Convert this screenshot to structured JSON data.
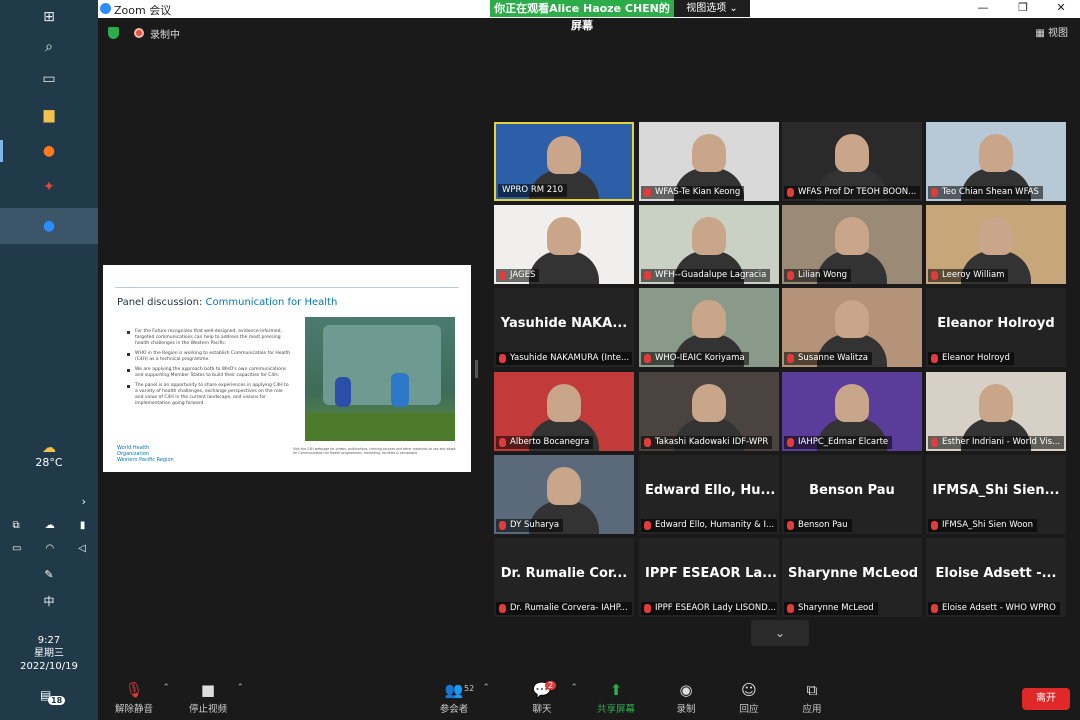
{
  "window": {
    "title": "Zoom 会议",
    "banner": "你正在观看Alice Haoze CHEN的屏幕",
    "view_options": "视图选项 ⌄",
    "controls": [
      "—",
      "❐",
      "✕"
    ]
  },
  "status": {
    "recording_label": "录制中",
    "view_label": "视图"
  },
  "shared_slide": {
    "title_prefix": "Panel discussion: ",
    "title_highlight": "Communication for Health",
    "bullets": [
      "For the Future recognizes that well-designed, evidence-informed, targeted communications can help to address the most pressing health challenges in the Western Pacific.",
      "WHO in the Region is working to establish Communication for Health (C4H) as a technical programme.",
      "We are applying the approach both to WHO's own communications and supporting Member States to build their capacities for C4H.",
      "The panel is an opportunity to share experiences in applying C4H to a variety of health challenges, exchange perspectives on the role and value of C4H in the current landscape, and visions for implementation going forward."
    ],
    "org_line1": "World Health",
    "org_line2": "Organization",
    "org_line3": "Western Pacific Region",
    "caption": "Visit the C4H webpage for videos, publications, training courses and other materials to use and adapt for Communication for Health programmes, marketing, facilities & campaigns"
  },
  "participants": [
    {
      "label": "WPRO RM 210",
      "big_name": "",
      "video": true,
      "active": true,
      "bg": "#2c5fa8",
      "muted": false
    },
    {
      "label": "WFAS-Te Kian Keong",
      "big_name": "",
      "video": true,
      "bg": "#d9d9d9"
    },
    {
      "label": "WFAS Prof Dr TEOH BOON...",
      "big_name": "",
      "video": true,
      "bg": "#2a2a2a"
    },
    {
      "label": "Teo Chian Shean WFAS",
      "big_name": "",
      "video": true,
      "bg": "#b7c9d6"
    },
    {
      "label": "JAGES",
      "big_name": "",
      "video": true,
      "bg": "#f0efee"
    },
    {
      "label": "WFH--Guadalupe Lagracia",
      "big_name": "",
      "video": true,
      "bg": "#c9d1c5"
    },
    {
      "label": "Lilian Wong",
      "big_name": "",
      "video": true,
      "bg": "#9b8a76"
    },
    {
      "label": "Leeroy William",
      "big_name": "",
      "video": true,
      "bg": "#c7a77a"
    },
    {
      "label": "Yasuhide NAKAMURA (Inte...",
      "big_name": "Yasuhide NAKA...",
      "video": false
    },
    {
      "label": "WHO-IEAIC Koriyama",
      "big_name": "",
      "video": true,
      "bg": "#8a9a8a"
    },
    {
      "label": "Susanne Walitza",
      "big_name": "",
      "video": true,
      "bg": "#b49378"
    },
    {
      "label": "Eleanor Holroyd",
      "big_name": "Eleanor Holroyd",
      "video": false
    },
    {
      "label": "Alberto Bocanegra",
      "big_name": "",
      "video": true,
      "bg": "#c23a3a"
    },
    {
      "label": "Takashi Kadowaki IDF-WPR",
      "big_name": "",
      "video": true,
      "bg": "#4a4340"
    },
    {
      "label": "IAHPC_Edmar Elcarte",
      "big_name": "",
      "video": true,
      "bg": "#5a3c9a"
    },
    {
      "label": "Esther Indriani - World Vis...",
      "big_name": "",
      "video": true,
      "bg": "#d6d0c6"
    },
    {
      "label": "DY Suharya",
      "big_name": "",
      "video": true,
      "bg": "#5a6a7a"
    },
    {
      "label": "Edward Ello, Humanity & I...",
      "big_name": "Edward Ello, Hu...",
      "video": false
    },
    {
      "label": "Benson Pau",
      "big_name": "Benson Pau",
      "video": false
    },
    {
      "label": "IFMSA_Shi Sien Woon",
      "big_name": "IFMSA_Shi Sien...",
      "video": false
    },
    {
      "label": "Dr. Rumalie Corvera- IAHP...",
      "big_name": "Dr. Rumalie Cor...",
      "video": false
    },
    {
      "label": "IPPF ESEAOR Lady LISOND...",
      "big_name": "IPPF ESEAOR La...",
      "video": false
    },
    {
      "label": "Sharynne McLeod",
      "big_name": "Sharynne McLeod",
      "video": false
    },
    {
      "label": "Eloise Adsett - WHO WPRO",
      "big_name": "Eloise Adsett -...",
      "video": false
    }
  ],
  "more_tiles_icon": "chevron-down",
  "toolbar": {
    "unmute": "解除静音",
    "stop_video": "停止视频",
    "participants": "参会者",
    "participants_count": "52",
    "chat": "聊天",
    "chat_badge": "2",
    "share_screen": "共享屏幕",
    "record": "录制",
    "reactions": "回应",
    "apps": "应用",
    "leave": "离开"
  },
  "system": {
    "temperature": "28°C",
    "ime": "中",
    "time": "9:27",
    "weekday": "星期三",
    "date": "2022/10/19",
    "notifications": "18"
  },
  "colors": {
    "accent_green": "#2dad4a",
    "leave_red": "#e02828",
    "active_speaker": "#e4d23a",
    "taskbar": "#203a4a"
  }
}
